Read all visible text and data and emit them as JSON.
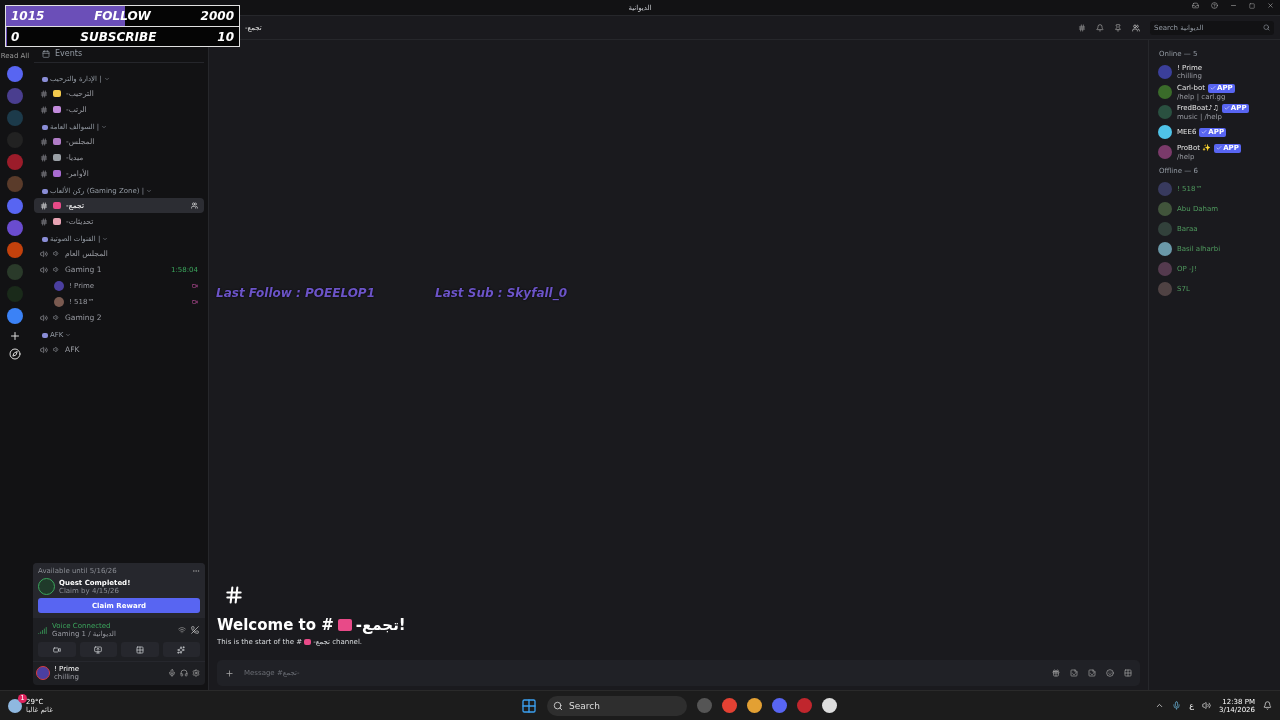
{
  "window": {
    "title": "الديوانية"
  },
  "overlay": {
    "follow": {
      "current": "1015",
      "label": "FOLLOW",
      "goal": "2000",
      "level": 0.51
    },
    "subscribe": {
      "current": "0",
      "label": "SUBSCRIBE",
      "goal": "10",
      "level": 0
    },
    "last_follow": "Last Follow : POEELOP1",
    "last_sub": "Last Sub : Skyfall_0"
  },
  "rail": {
    "read_all": "Read All"
  },
  "header": {
    "channel": "تجمع-",
    "search_placeholder": "Search الديوانية"
  },
  "sidebar": {
    "events": "Events",
    "categories": [
      {
        "name": "الإدارة والترحيب |",
        "expanded": true,
        "channels": [
          {
            "kind": "text",
            "name": "الترحيب-",
            "selected": false
          },
          {
            "kind": "text",
            "name": "الرتب-",
            "selected": false
          }
        ]
      },
      {
        "name": "السوالف العامة |",
        "expanded": true,
        "channels": [
          {
            "kind": "text",
            "name": "المجلس-",
            "selected": false
          },
          {
            "kind": "text",
            "name": "ميديا-",
            "selected": false
          },
          {
            "kind": "text",
            "name": "الأوامر-",
            "selected": false
          }
        ]
      },
      {
        "name": "ركن الألعاب (Gaming Zone) |",
        "expanded": true,
        "channels": [
          {
            "kind": "text",
            "name": "تجمع-",
            "selected": true
          },
          {
            "kind": "text",
            "name": "تحديثات-",
            "selected": false
          }
        ]
      },
      {
        "name": "القنوات الصوتية |",
        "expanded": true,
        "channels": [
          {
            "kind": "voice",
            "name": "المجلس العام",
            "selected": false
          },
          {
            "kind": "voice",
            "name": "Gaming 1",
            "selected": false,
            "timer": "1:58:04",
            "users": [
              {
                "name": "! Prime"
              },
              {
                "name": "! 518™"
              }
            ]
          },
          {
            "kind": "voice",
            "name": "Gaming 2",
            "selected": false
          }
        ]
      },
      {
        "name": "AFK",
        "expanded": true,
        "channels": [
          {
            "kind": "voice",
            "name": "AFK",
            "selected": false
          }
        ]
      }
    ]
  },
  "quest": {
    "availability": "Available until 5/16/26",
    "title": "Quest Completed!",
    "claim_by": "Claim by 4/15/26",
    "button": "Claim Reward"
  },
  "voice": {
    "status": "Voice Connected",
    "channel": "Gaming 1 / الديوانية"
  },
  "user": {
    "name": "! Prime",
    "status": "chilling"
  },
  "main": {
    "welcome": "Welcome to #",
    "channel": "تجمع-",
    "welcome_end": "!",
    "intro": "This is the start of the #",
    "intro_end": " channel.",
    "intro_channel": "تجمع-",
    "composer_placeholder": "Message #تجمع-"
  },
  "members": {
    "groups": [
      {
        "title": "Online — 5",
        "online": true,
        "members": [
          {
            "name": "! Prime",
            "subtitle": "chilling"
          },
          {
            "name": "Carl-bot",
            "badge": "APP",
            "subtitle": "/help | carl.gg"
          },
          {
            "name": "FredBoat♪♫",
            "badge": "APP",
            "subtitle": "music | /help"
          },
          {
            "name": "MEE6",
            "badge": "APP"
          },
          {
            "name": "ProBot ✨",
            "badge": "APP",
            "subtitle": "/help"
          }
        ]
      },
      {
        "title": "Offline — 6",
        "online": false,
        "members": [
          {
            "name": "! 518™"
          },
          {
            "name": "Abu Daham"
          },
          {
            "name": "Baraa"
          },
          {
            "name": "Basil alharbi"
          },
          {
            "name": "OP -J!"
          },
          {
            "name": "S7L"
          }
        ]
      }
    ]
  },
  "taskbar": {
    "search": "Search",
    "temperature": "29°C",
    "weather": "غائم غالبا",
    "weather_badge": "1",
    "language": "ع",
    "time": "12:38 PM",
    "date": "3/14/2026"
  }
}
